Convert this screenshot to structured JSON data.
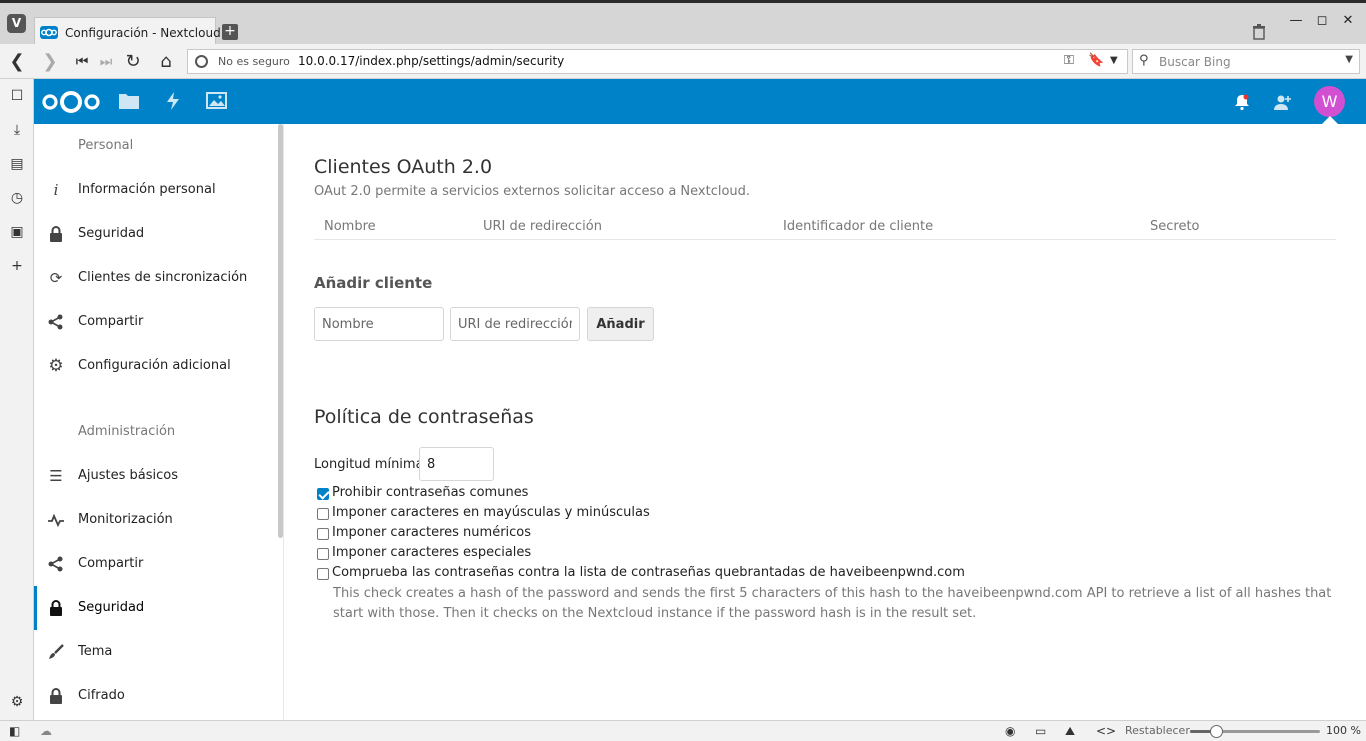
{
  "browser": {
    "tab_title": "Configuración - Nextcloud",
    "url_insecure_label": "No es seguro",
    "url": "10.0.0.17/index.php/settings/admin/security",
    "search_placeholder": "Buscar Bing",
    "reset_label": "Restablecer",
    "zoom_label": "100 %",
    "zoom_level": 0.2
  },
  "header": {
    "avatar_letter": "W",
    "brand_color": "#0082c9",
    "avatar_color": "#d14fd1"
  },
  "sidebar": {
    "personal_heading": "Personal",
    "personal_items": [
      {
        "label": "Información personal",
        "icon": "info-icon"
      },
      {
        "label": "Seguridad",
        "icon": "lock-icon"
      },
      {
        "label": "Clientes de sincronización",
        "icon": "sync-icon"
      },
      {
        "label": "Compartir",
        "icon": "share-icon"
      },
      {
        "label": "Configuración adicional",
        "icon": "gear-icon"
      }
    ],
    "admin_heading": "Administración",
    "admin_items": [
      {
        "label": "Ajustes básicos",
        "icon": "list-icon"
      },
      {
        "label": "Monitorización",
        "icon": "activity-icon"
      },
      {
        "label": "Compartir",
        "icon": "share-icon"
      },
      {
        "label": "Seguridad",
        "icon": "lock-icon",
        "active": true
      },
      {
        "label": "Tema",
        "icon": "brush-icon"
      },
      {
        "label": "Cifrado",
        "icon": "lock-icon"
      }
    ]
  },
  "oauth": {
    "title": "Clientes OAuth 2.0",
    "hint": "OAut 2.0 permite a servicios externos solicitar acceso a Nextcloud.",
    "columns": [
      "Nombre",
      "URI de redirección",
      "Identificador de cliente",
      "Secreto"
    ],
    "add_title": "Añadir cliente",
    "name_placeholder": "Nombre",
    "uri_placeholder": "URI de redirección",
    "add_button": "Añadir"
  },
  "password_policy": {
    "title": "Política de contraseñas",
    "min_length_label": "Longitud mínima",
    "min_length_value": "8",
    "options": [
      {
        "label": "Prohibir contraseñas comunes",
        "checked": true
      },
      {
        "label": "Imponer caracteres en mayúsculas y minúsculas",
        "checked": false
      },
      {
        "label": "Imponer caracteres numéricos",
        "checked": false
      },
      {
        "label": "Imponer caracteres especiales",
        "checked": false
      },
      {
        "label": "Comprueba las contraseñas contra la lista de contraseñas quebrantadas de haveibeenpwnd.com",
        "checked": false
      }
    ],
    "hibp_description": "This check creates a hash of the password and sends the first 5 characters of this hash to the haveibeenpwnd.com API to retrieve a list of all hashes that start with those. Then it checks on the Nextcloud instance if the password hash is in the result set."
  }
}
